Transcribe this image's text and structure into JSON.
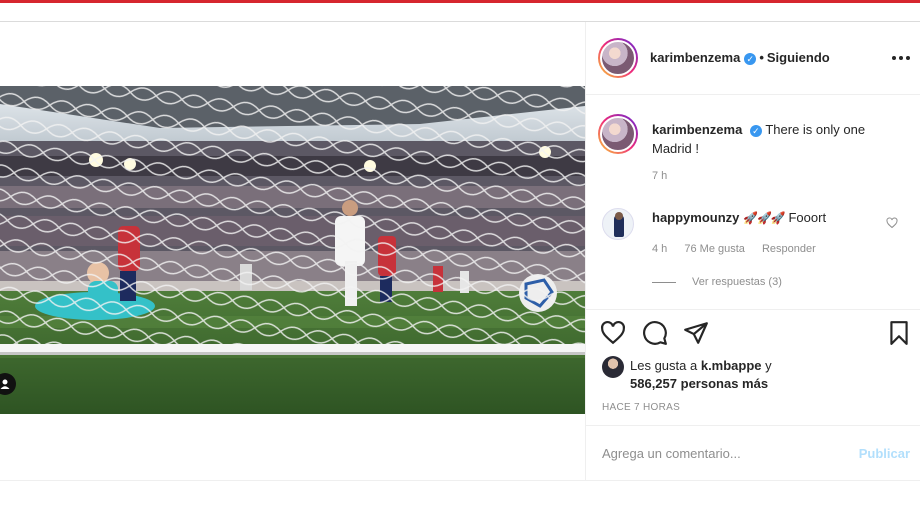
{
  "post": {
    "username": "karimbenzema",
    "verified_mark": "✓",
    "separator": "•",
    "follow_status": "Siguiendo",
    "caption": "There is only one Madrid !",
    "caption_time": "7 h",
    "photo_description_icon": "user-tag-icon",
    "likes_prefix": "Les gusta a",
    "likes_user": "k.mbappe",
    "likes_conjunction": "y",
    "likes_count": "586,257",
    "likes_suffix": "personas más",
    "posted_ago": "HACE 7 HORAS"
  },
  "comment": {
    "username": "happymounzy",
    "rockets": "🚀🚀🚀",
    "text": "Fooort",
    "time": "4 h",
    "likes": "76 Me gusta",
    "reply": "Responder",
    "view_replies": "Ver respuestas (3)"
  },
  "composer": {
    "placeholder": "Agrega un comentario...",
    "publish": "Publicar"
  },
  "icons": [
    "heart-icon",
    "comment-icon",
    "share-icon",
    "save-icon",
    "more-icon",
    "verified-icon"
  ],
  "colors": {
    "top_bar": "#d6262e",
    "verified": "#3897f0",
    "publish_disabled": "#b2dffc",
    "muted": "#8e8e8e"
  }
}
